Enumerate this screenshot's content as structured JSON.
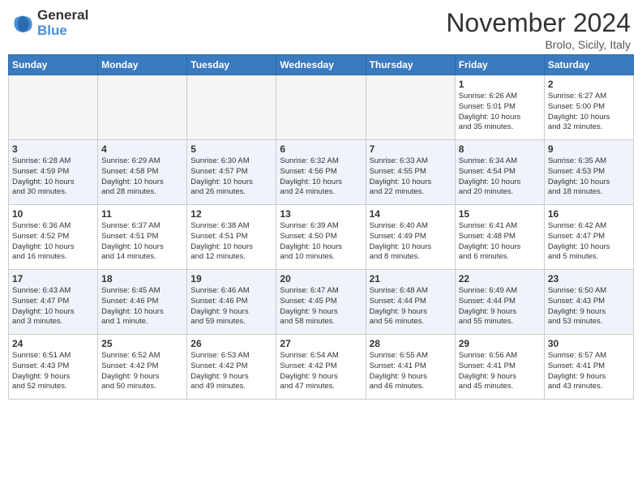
{
  "header": {
    "logo_line1": "General",
    "logo_line2": "Blue",
    "title": "November 2024",
    "subtitle": "Brolo, Sicily, Italy"
  },
  "weekdays": [
    "Sunday",
    "Monday",
    "Tuesday",
    "Wednesday",
    "Thursday",
    "Friday",
    "Saturday"
  ],
  "weeks": [
    [
      {
        "day": "",
        "info": ""
      },
      {
        "day": "",
        "info": ""
      },
      {
        "day": "",
        "info": ""
      },
      {
        "day": "",
        "info": ""
      },
      {
        "day": "",
        "info": ""
      },
      {
        "day": "1",
        "info": "Sunrise: 6:26 AM\nSunset: 5:01 PM\nDaylight: 10 hours\nand 35 minutes."
      },
      {
        "day": "2",
        "info": "Sunrise: 6:27 AM\nSunset: 5:00 PM\nDaylight: 10 hours\nand 32 minutes."
      }
    ],
    [
      {
        "day": "3",
        "info": "Sunrise: 6:28 AM\nSunset: 4:59 PM\nDaylight: 10 hours\nand 30 minutes."
      },
      {
        "day": "4",
        "info": "Sunrise: 6:29 AM\nSunset: 4:58 PM\nDaylight: 10 hours\nand 28 minutes."
      },
      {
        "day": "5",
        "info": "Sunrise: 6:30 AM\nSunset: 4:57 PM\nDaylight: 10 hours\nand 26 minutes."
      },
      {
        "day": "6",
        "info": "Sunrise: 6:32 AM\nSunset: 4:56 PM\nDaylight: 10 hours\nand 24 minutes."
      },
      {
        "day": "7",
        "info": "Sunrise: 6:33 AM\nSunset: 4:55 PM\nDaylight: 10 hours\nand 22 minutes."
      },
      {
        "day": "8",
        "info": "Sunrise: 6:34 AM\nSunset: 4:54 PM\nDaylight: 10 hours\nand 20 minutes."
      },
      {
        "day": "9",
        "info": "Sunrise: 6:35 AM\nSunset: 4:53 PM\nDaylight: 10 hours\nand 18 minutes."
      }
    ],
    [
      {
        "day": "10",
        "info": "Sunrise: 6:36 AM\nSunset: 4:52 PM\nDaylight: 10 hours\nand 16 minutes."
      },
      {
        "day": "11",
        "info": "Sunrise: 6:37 AM\nSunset: 4:51 PM\nDaylight: 10 hours\nand 14 minutes."
      },
      {
        "day": "12",
        "info": "Sunrise: 6:38 AM\nSunset: 4:51 PM\nDaylight: 10 hours\nand 12 minutes."
      },
      {
        "day": "13",
        "info": "Sunrise: 6:39 AM\nSunset: 4:50 PM\nDaylight: 10 hours\nand 10 minutes."
      },
      {
        "day": "14",
        "info": "Sunrise: 6:40 AM\nSunset: 4:49 PM\nDaylight: 10 hours\nand 8 minutes."
      },
      {
        "day": "15",
        "info": "Sunrise: 6:41 AM\nSunset: 4:48 PM\nDaylight: 10 hours\nand 6 minutes."
      },
      {
        "day": "16",
        "info": "Sunrise: 6:42 AM\nSunset: 4:47 PM\nDaylight: 10 hours\nand 5 minutes."
      }
    ],
    [
      {
        "day": "17",
        "info": "Sunrise: 6:43 AM\nSunset: 4:47 PM\nDaylight: 10 hours\nand 3 minutes."
      },
      {
        "day": "18",
        "info": "Sunrise: 6:45 AM\nSunset: 4:46 PM\nDaylight: 10 hours\nand 1 minute."
      },
      {
        "day": "19",
        "info": "Sunrise: 6:46 AM\nSunset: 4:46 PM\nDaylight: 9 hours\nand 59 minutes."
      },
      {
        "day": "20",
        "info": "Sunrise: 6:47 AM\nSunset: 4:45 PM\nDaylight: 9 hours\nand 58 minutes."
      },
      {
        "day": "21",
        "info": "Sunrise: 6:48 AM\nSunset: 4:44 PM\nDaylight: 9 hours\nand 56 minutes."
      },
      {
        "day": "22",
        "info": "Sunrise: 6:49 AM\nSunset: 4:44 PM\nDaylight: 9 hours\nand 55 minutes."
      },
      {
        "day": "23",
        "info": "Sunrise: 6:50 AM\nSunset: 4:43 PM\nDaylight: 9 hours\nand 53 minutes."
      }
    ],
    [
      {
        "day": "24",
        "info": "Sunrise: 6:51 AM\nSunset: 4:43 PM\nDaylight: 9 hours\nand 52 minutes."
      },
      {
        "day": "25",
        "info": "Sunrise: 6:52 AM\nSunset: 4:42 PM\nDaylight: 9 hours\nand 50 minutes."
      },
      {
        "day": "26",
        "info": "Sunrise: 6:53 AM\nSunset: 4:42 PM\nDaylight: 9 hours\nand 49 minutes."
      },
      {
        "day": "27",
        "info": "Sunrise: 6:54 AM\nSunset: 4:42 PM\nDaylight: 9 hours\nand 47 minutes."
      },
      {
        "day": "28",
        "info": "Sunrise: 6:55 AM\nSunset: 4:41 PM\nDaylight: 9 hours\nand 46 minutes."
      },
      {
        "day": "29",
        "info": "Sunrise: 6:56 AM\nSunset: 4:41 PM\nDaylight: 9 hours\nand 45 minutes."
      },
      {
        "day": "30",
        "info": "Sunrise: 6:57 AM\nSunset: 4:41 PM\nDaylight: 9 hours\nand 43 minutes."
      }
    ]
  ]
}
